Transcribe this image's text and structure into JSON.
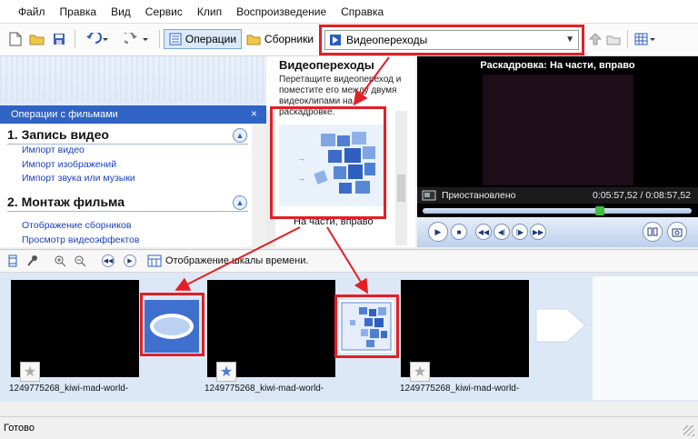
{
  "menu": [
    "Файл",
    "Правка",
    "Вид",
    "Сервис",
    "Клип",
    "Воспроизведение",
    "Справка"
  ],
  "toolbar": {
    "operations_label": "Операции",
    "collections_label": "Сборники",
    "collection_selected": "Видеопереходы"
  },
  "tasks_pane": {
    "header": "Операции с фильмами",
    "close_glyph": "×",
    "sections": [
      {
        "title": "1. Запись видео",
        "links": [
          "Импорт видео",
          "Импорт изображений",
          "Импорт звука или музыки"
        ]
      },
      {
        "title": "2. Монтаж фильма",
        "links": [
          "Отображение сборников",
          "Просмотр видеоэффектов"
        ]
      }
    ]
  },
  "collection_pane": {
    "title": "Видеопереходы",
    "description": "Перетащите видеопереход и поместите его между двумя видеоклипами на раскадровке.",
    "selected_item": "На части, вправо"
  },
  "preview": {
    "title": "Раскадровка: На части, вправо",
    "status": "Приостановлено",
    "time": "0:05:57,52 / 0:08:57,52",
    "position": 0.66
  },
  "timeline": {
    "toggle_label": "Отображение шкалы времени.",
    "clips": [
      {
        "label": "1249775268_kiwi-mad-world-"
      },
      {
        "label": "1249775268_kiwi-mad-world-"
      },
      {
        "label": "1249775268_kiwi-mad-world-"
      }
    ]
  },
  "statusbar": {
    "text": "Готово"
  },
  "colors": {
    "accent": "#2f63c4",
    "highlight": "#e21f26",
    "link": "#1a3fbf"
  }
}
